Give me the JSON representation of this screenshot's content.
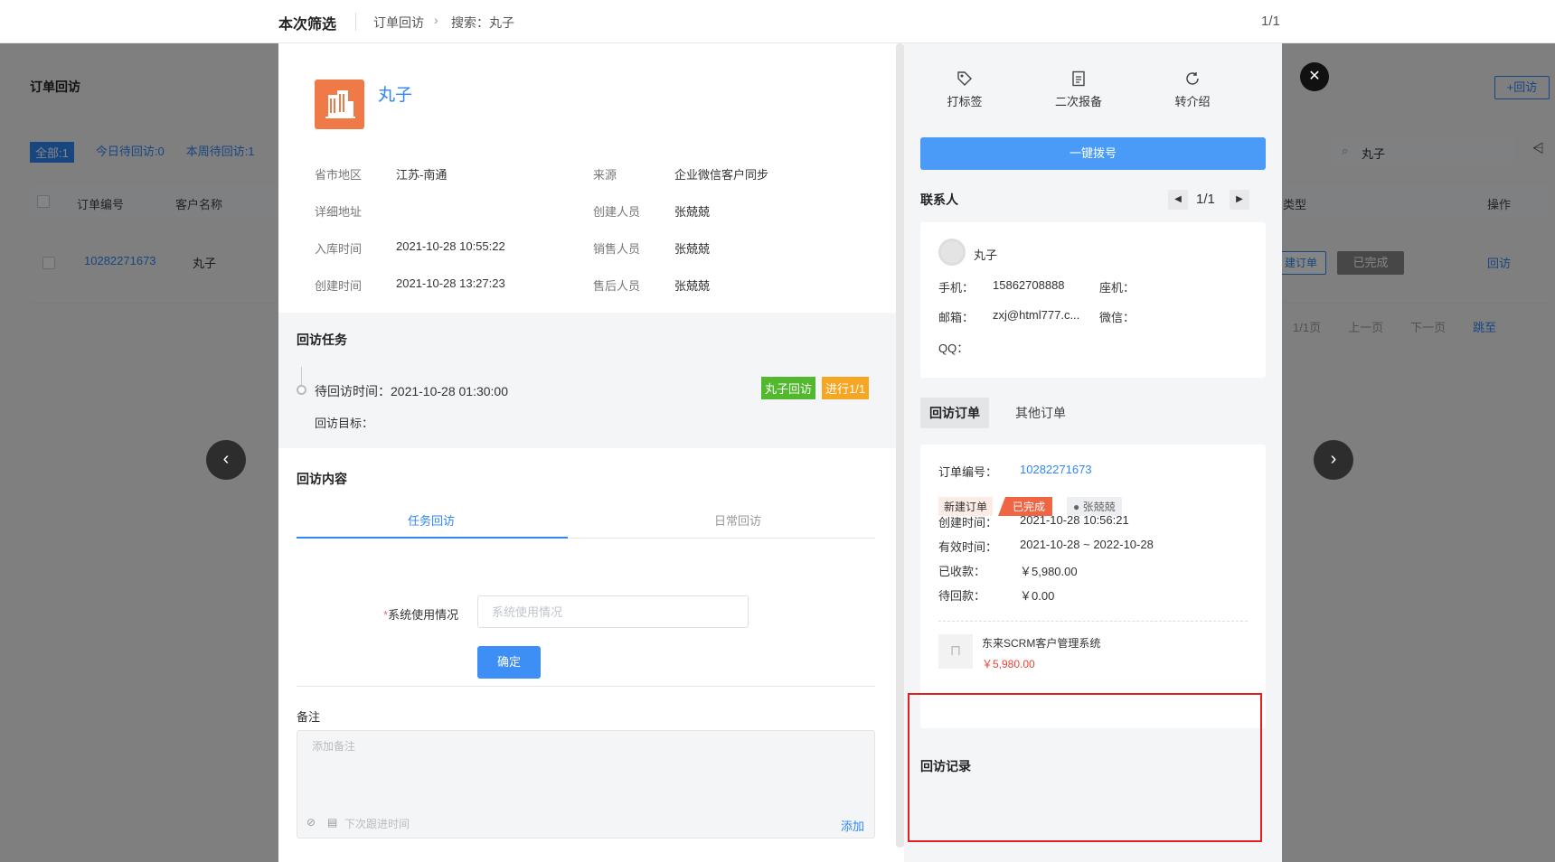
{
  "topbar": {
    "title": "本次筛选",
    "crumb1": "订单回访",
    "crumb_arrow": "›",
    "crumb2": "搜索：丸子",
    "page_indicator": "1/1"
  },
  "background_page": {
    "title": "订单回访",
    "tabs": [
      "全部:1",
      "今日待回访:0",
      "本周待回访:1"
    ],
    "add_button": "+回访",
    "search_value": "丸子",
    "table_headers": [
      "订单编号",
      "客户名称",
      "类型",
      "操作"
    ],
    "row": {
      "order_no": "10282271673",
      "customer": "丸子",
      "btn_blue": "建订单",
      "btn_gray": "已完成",
      "op": "回访"
    },
    "pager": [
      "1/1页",
      "上一页",
      "下一页",
      "跳至"
    ]
  },
  "customer": {
    "name": "丸子",
    "fields": [
      {
        "label": "省市地区",
        "value": "江苏-南通"
      },
      {
        "label": "来源",
        "value": "企业微信客户同步"
      },
      {
        "label": "详细地址",
        "value": ""
      },
      {
        "label": "创建人员",
        "value": "张兢兢"
      },
      {
        "label": "入库时间",
        "value": "2021-10-28 10:55:22"
      },
      {
        "label": "销售人员",
        "value": "张兢兢"
      },
      {
        "label": "创建时间",
        "value": "2021-10-28 13:27:23"
      },
      {
        "label": "售后人员",
        "value": "张兢兢"
      }
    ]
  },
  "task": {
    "section_title": "回访任务",
    "pending_time": "待回访时间：2021-10-28 01:30:00",
    "goal": "回访目标：",
    "tag_green": "丸子回访",
    "tag_orange": "进行1/1"
  },
  "content": {
    "section_title": "回访内容",
    "tabs": [
      "任务回访",
      "日常回访"
    ],
    "field_required": "*",
    "field_label": "系统使用情况",
    "field_placeholder": "系统使用情况",
    "confirm": "确定",
    "remark_label": "备注",
    "remark_placeholder": "添加备注",
    "next_follow": "下次跟进时间",
    "add": "添加"
  },
  "right_panel": {
    "actions": [
      "打标签",
      "二次报备",
      "转介绍"
    ],
    "dial": "一键拨号",
    "contact_title": "联系人",
    "contact_page": "1/1",
    "contact": {
      "name": "丸子",
      "phone_label": "手机：",
      "phone": "15862708888",
      "landline_label": "座机：",
      "landline": "",
      "email_label": "邮箱：",
      "email": "zxj@html777.c...",
      "wechat_label": "微信：",
      "wechat": "",
      "qq_label": "QQ：",
      "qq": ""
    },
    "tabs": [
      "回访订单",
      "其他订单"
    ],
    "order": {
      "no_label": "订单编号：",
      "no": "10282271673",
      "badge_new": "新建订单",
      "badge_done": "已完成",
      "badge_user": "张兢兢",
      "created_label": "创建时间：",
      "created": "2021-10-28 10:56:21",
      "valid_label": "有效时间：",
      "valid": "2021-10-28 ~ 2022-10-28",
      "received_label": "已收款：",
      "received": "￥5,980.00",
      "pending_label": "待回款：",
      "pending": "￥0.00",
      "product_name": "东来SCRM客户管理系统",
      "product_price": "￥5,980.00"
    },
    "record_title": "回访记录"
  },
  "colors": {
    "accent": "#2f86f6",
    "highlight_frame": "#e02020",
    "logo": "#f07a47"
  }
}
